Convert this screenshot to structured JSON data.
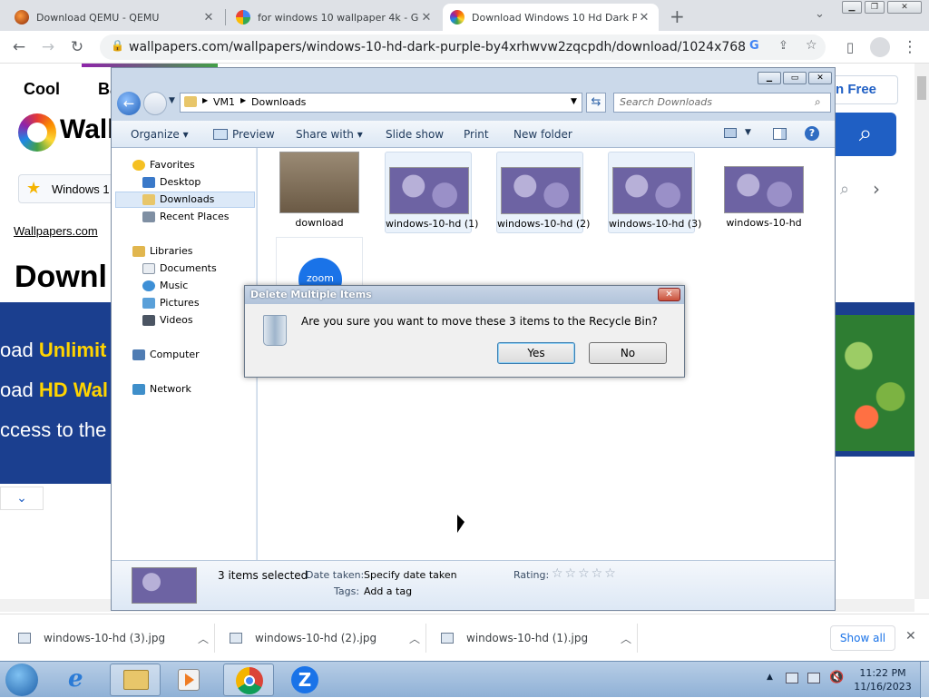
{
  "browser": {
    "tabs": [
      {
        "label": "Download QEMU - QEMU",
        "favicon": "qemu-icon",
        "active": false
      },
      {
        "label": "for windows 10 wallpaper 4k - Goog",
        "favicon": "google-icon",
        "active": false
      },
      {
        "label": "Download Windows 10 Hd Dark Pur",
        "favicon": "wallpapers-icon",
        "active": true
      }
    ],
    "new_tab_glyph": "+",
    "url": "wallpapers.com/wallpapers/windows-10-hd-dark-purple-by4xrhwvw2zqcpdh/download/1024x768"
  },
  "webpage": {
    "nav_cool": "Cool",
    "nav_ba": "Ba",
    "join_free": "n Free",
    "logo_text": "Wall",
    "search_tab": "Windows 1",
    "breadcrumb": "Wallpapers.com",
    "heading": "Downl",
    "banner": {
      "line1_a": "oad ",
      "line1_b": "Unlimit",
      "line2_a": "oad ",
      "line2_b": "HD Wal",
      "line3": "ccess to the"
    }
  },
  "explorer": {
    "breadcrumb": [
      "VM1",
      "Downloads"
    ],
    "search_placeholder": "Search Downloads",
    "commands": [
      "Organize",
      "Preview",
      "Share with",
      "Slide show",
      "Print",
      "New folder"
    ],
    "nav": {
      "favorites": "Favorites",
      "desktop": "Desktop",
      "downloads": "Downloads",
      "recent": "Recent Places",
      "libraries": "Libraries",
      "documents": "Documents",
      "music": "Music",
      "pictures": "Pictures",
      "videos": "Videos",
      "computer": "Computer",
      "network": "Network"
    },
    "files": [
      {
        "name": "download",
        "selected": false
      },
      {
        "name": "windows-10-hd (1)",
        "selected": true
      },
      {
        "name": "windows-10-hd (2)",
        "selected": true
      },
      {
        "name": "windows-10-hd (3)",
        "selected": true
      },
      {
        "name": "windows-10-hd",
        "selected": false
      }
    ],
    "partial_file_label": "zoom",
    "details": {
      "selection": "3 items selected",
      "date_label": "Date taken:",
      "date_value": "Specify date taken",
      "tags_label": "Tags:",
      "tags_value": "Add a tag",
      "rating_label": "Rating:",
      "rating_stars": 0
    }
  },
  "dialog": {
    "title": "Delete Multiple Items",
    "message": "Are you sure you want to move these 3 items to the Recycle Bin?",
    "yes": "Yes",
    "no": "No"
  },
  "downloads": {
    "items": [
      "windows-10-hd (3).jpg",
      "windows-10-hd (2).jpg",
      "windows-10-hd (1).jpg"
    ],
    "show_all": "Show all"
  },
  "taskbar": {
    "time": "11:22 PM",
    "date": "11/16/2023"
  },
  "colors": {
    "banner_blue": "#1b3f8f",
    "banner_yellow": "#ffd400",
    "search_blue": "#1f5fc4",
    "explorer_frame": "#cbd9ea"
  }
}
